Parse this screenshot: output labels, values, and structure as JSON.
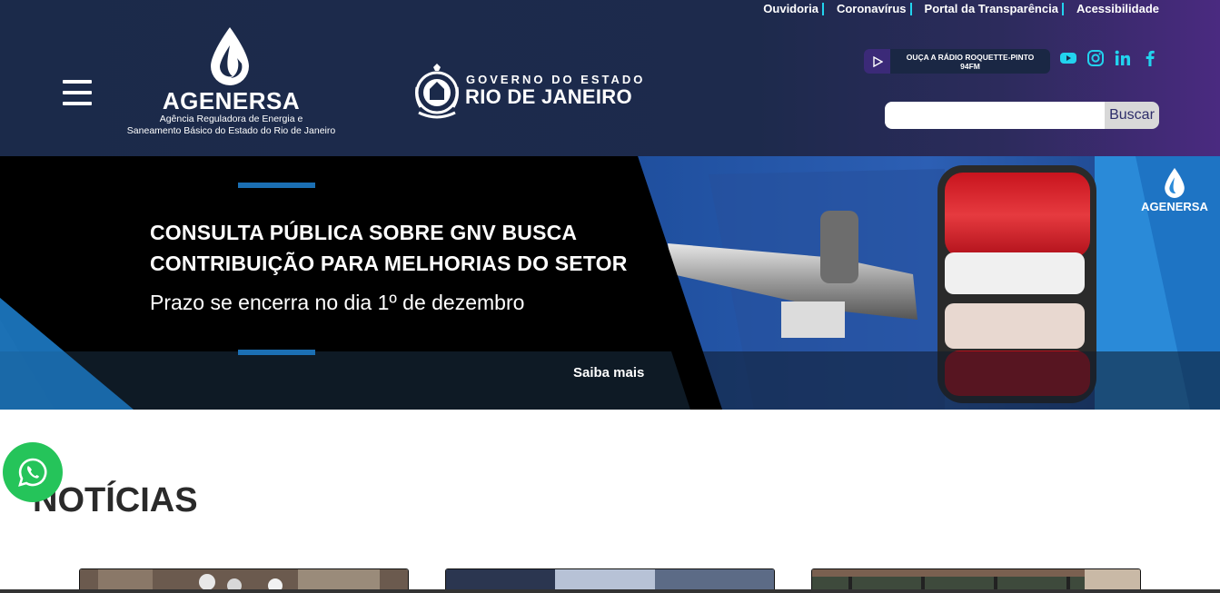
{
  "topnav": {
    "links": [
      "Ouvidoria",
      "Coronavírus",
      "Portal da Transparência",
      "Acessibilidade"
    ]
  },
  "brand": {
    "name": "AGENERSA",
    "subtitle_line1": "Agência Reguladora de Energia e",
    "subtitle_line2": "Saneamento Básico do Estado do Rio de Janeiro"
  },
  "government": {
    "line1": "GOVERNO DO ESTADO",
    "line2": "RIO DE JANEIRO"
  },
  "radio": {
    "label_line1": "OUÇA A RÁDIO ROQUETTE-PINTO",
    "label_line2": "94FM"
  },
  "social_icons": [
    "youtube-icon",
    "instagram-icon",
    "linkedin-icon",
    "facebook-icon"
  ],
  "search": {
    "placeholder": "",
    "button_label": "Buscar"
  },
  "banner": {
    "title_line1": "CONSULTA PÚBLICA SOBRE GNV BUSCA",
    "title_line2": "CONTRIBUIÇÃO PARA MELHORIAS DO SETOR",
    "subtitle": "Prazo se encerra no dia 1º de dezembro",
    "cta": "Saiba mais",
    "watermark": "AGENERSA"
  },
  "news": {
    "title": "NOTÍCIAS"
  },
  "colors": {
    "header_bg": "#1b2a4a",
    "header_accent": "#4a2a80",
    "separator": "#22d3ee",
    "social_icon": "#22d3ee",
    "banner_blue": "#1b6fb3",
    "whatsapp": "#25c45a"
  }
}
